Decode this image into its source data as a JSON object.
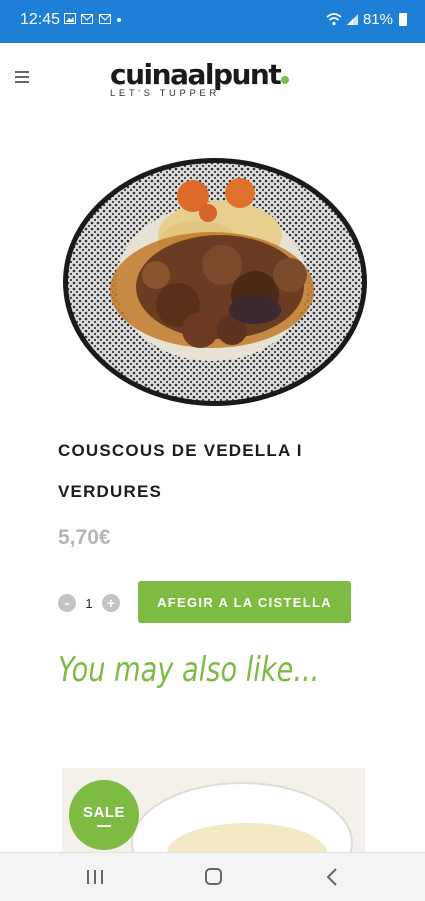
{
  "status_bar": {
    "time": "12:45",
    "notification_icons": [
      "image-icon",
      "mail-icon",
      "mail-icon",
      "dot-icon"
    ],
    "battery": "81%",
    "bar_color": "#1e7fd6"
  },
  "header": {
    "logo_text": "cuinaalpunt",
    "logo_tagline": "LET'S TUPPER",
    "menu_icon": "hamburger-icon"
  },
  "product": {
    "title": "COUSCOUS DE VEDELLA I VERDURES",
    "price": "5,70€",
    "quantity": "1",
    "minus_label": "-",
    "plus_label": "+",
    "add_to_cart_label": "AFEGIR A LA CISTELLA"
  },
  "related": {
    "heading": "You may also like...",
    "badge": "SALE"
  },
  "nav_bar": {
    "icons": [
      "recent-apps-icon",
      "home-icon",
      "back-icon"
    ]
  },
  "colors": {
    "accent": "#7dbb42",
    "price": "#b5b5b5",
    "status_bar": "#1e7fd6"
  }
}
